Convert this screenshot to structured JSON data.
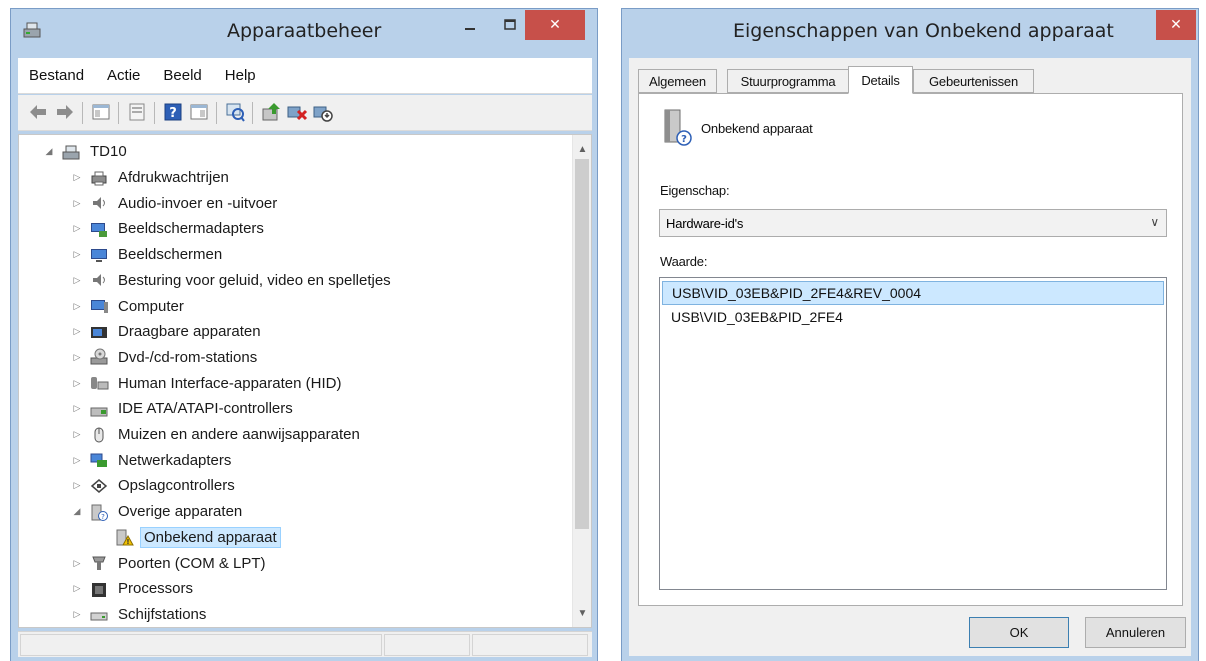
{
  "device_manager": {
    "title": "Apparaatbeheer",
    "menu": [
      "Bestand",
      "Actie",
      "Beeld",
      "Help"
    ],
    "toolbar": [
      {
        "icon": "back-arrow-icon"
      },
      {
        "icon": "forward-arrow-icon"
      },
      {
        "icon": "show-hide-console-tree-icon"
      },
      {
        "icon": "properties-icon"
      },
      {
        "icon": "help-icon"
      },
      {
        "icon": "action-pane-icon"
      },
      {
        "icon": "scan-hardware-icon"
      },
      {
        "icon": "update-driver-icon"
      },
      {
        "icon": "uninstall-device-icon"
      },
      {
        "icon": "disable-device-icon"
      }
    ],
    "tree": {
      "root": "TD10",
      "items": [
        {
          "label": "Afdrukwachtrijen",
          "icon": "printer-icon"
        },
        {
          "label": "Audio-invoer en -uitvoer",
          "icon": "speaker-icon"
        },
        {
          "label": "Beeldschermadapters",
          "icon": "display-adapter-icon"
        },
        {
          "label": "Beeldschermen",
          "icon": "monitor-icon"
        },
        {
          "label": "Besturing voor geluid, video en spelletjes",
          "icon": "speaker-icon"
        },
        {
          "label": "Computer",
          "icon": "computer-icon"
        },
        {
          "label": "Draagbare apparaten",
          "icon": "portable-device-icon"
        },
        {
          "label": "Dvd-/cd-rom-stations",
          "icon": "optical-drive-icon"
        },
        {
          "label": "Human Interface-apparaten (HID)",
          "icon": "hid-icon"
        },
        {
          "label": "IDE ATA/ATAPI-controllers",
          "icon": "ide-controller-icon"
        },
        {
          "label": "Muizen en andere aanwijsapparaten",
          "icon": "mouse-icon"
        },
        {
          "label": "Netwerkadapters",
          "icon": "network-adapter-icon"
        },
        {
          "label": "Opslagcontrollers",
          "icon": "storage-controller-icon"
        },
        {
          "label": "Overige apparaten",
          "icon": "unknown-device-icon"
        },
        {
          "label": "Onbekend apparaat",
          "icon": "warning-device-icon"
        },
        {
          "label": "Poorten (COM & LPT)",
          "icon": "port-icon"
        },
        {
          "label": "Processors",
          "icon": "processor-icon"
        },
        {
          "label": "Schijfstations",
          "icon": "disk-drive-icon"
        }
      ]
    }
  },
  "properties_dialog": {
    "title": "Eigenschappen van Onbekend apparaat",
    "tabs": [
      "Algemeen",
      "Stuurprogramma",
      "Details",
      "Gebeurtenissen"
    ],
    "active_tab": "Details",
    "device_name": "Onbekend apparaat",
    "property_label": "Eigenschap:",
    "property_selected": "Hardware-id's",
    "value_label": "Waarde:",
    "values": [
      "USB\\VID_03EB&PID_2FE4&REV_0004",
      "USB\\VID_03EB&PID_2FE4"
    ],
    "ok_label": "OK",
    "cancel_label": "Annuleren"
  },
  "colors": {
    "frame": "#b9d1ea",
    "close_button": "#c7504a",
    "selection": "#cce8ff"
  }
}
